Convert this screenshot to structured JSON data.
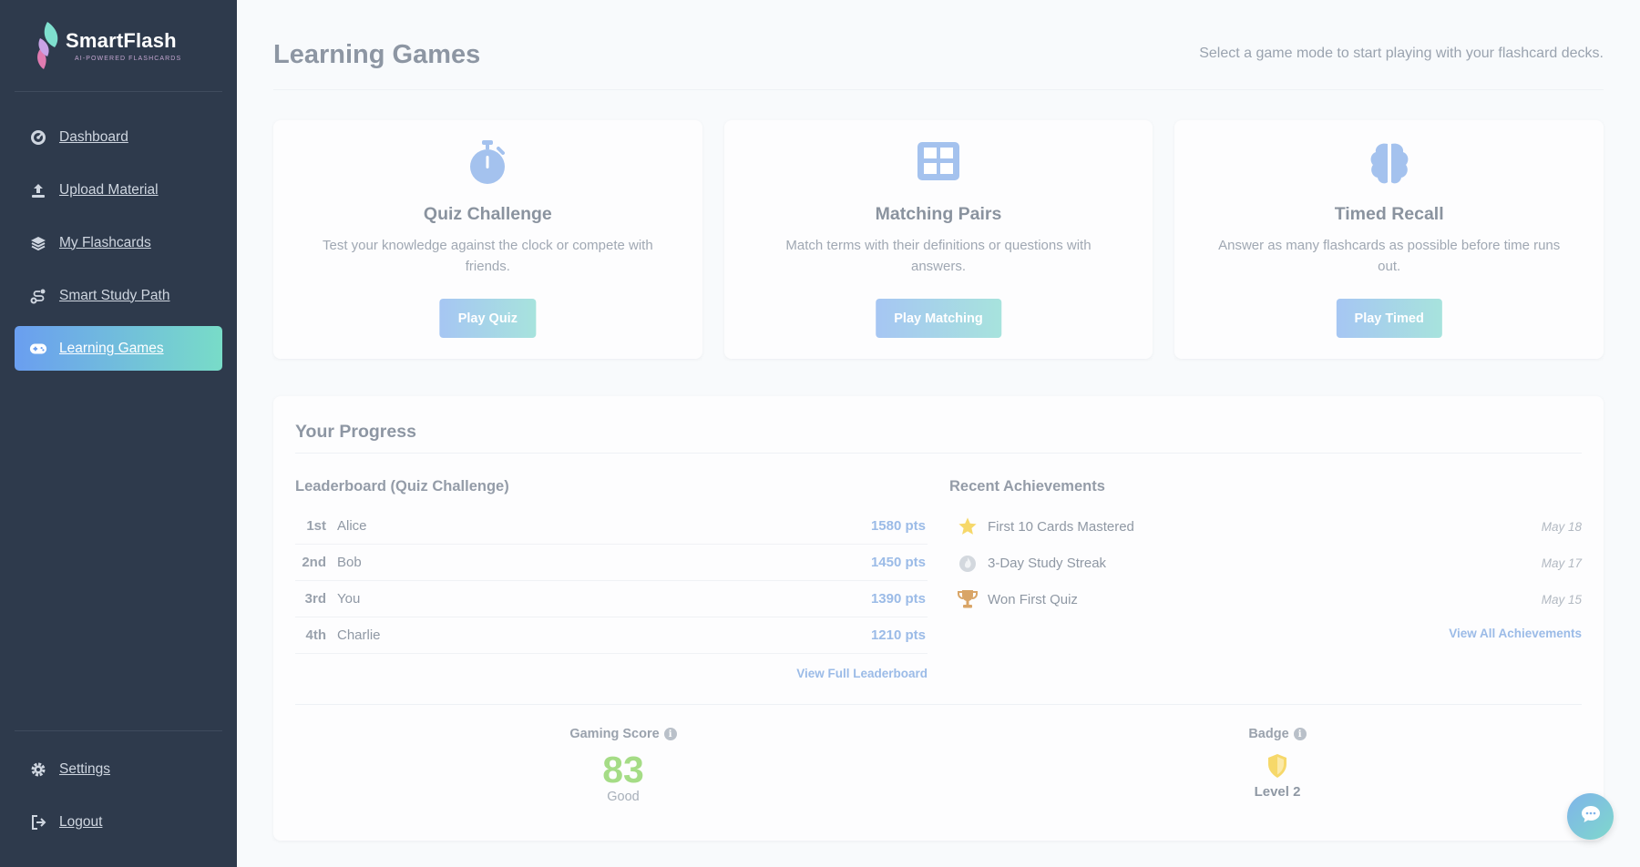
{
  "app": {
    "name": "SmartFlash",
    "tagline": "AI-POWERED FLASHCARDS"
  },
  "sidebar": {
    "items": [
      {
        "label": "Dashboard",
        "icon": "gauge-icon",
        "active": false
      },
      {
        "label": "Upload Material",
        "icon": "upload-icon",
        "active": false
      },
      {
        "label": "My Flashcards",
        "icon": "layers-icon",
        "active": false
      },
      {
        "label": "Smart Study Path",
        "icon": "route-icon",
        "active": false
      },
      {
        "label": "Learning Games",
        "icon": "gamepad-icon",
        "active": true
      }
    ],
    "bottom_items": [
      {
        "label": "Settings",
        "icon": "gear-icon"
      },
      {
        "label": "Logout",
        "icon": "logout-icon"
      }
    ]
  },
  "header": {
    "title": "Learning Games",
    "subtitle": "Select a game mode to start playing with your flashcard decks."
  },
  "games": [
    {
      "title": "Quiz Challenge",
      "description": "Test your knowledge against the clock or compete with friends.",
      "button": "Play Quiz",
      "icon": "stopwatch-icon"
    },
    {
      "title": "Matching Pairs",
      "description": "Match terms with their definitions or questions with answers.",
      "button": "Play Matching",
      "icon": "grid-icon"
    },
    {
      "title": "Timed Recall",
      "description": "Answer as many flashcards as possible before time runs out.",
      "button": "Play Timed",
      "icon": "brain-icon"
    }
  ],
  "progress": {
    "title": "Your Progress",
    "leaderboard": {
      "title": "Leaderboard (Quiz Challenge)",
      "rows": [
        {
          "rank": "1st",
          "name": "Alice",
          "points": "1580 pts"
        },
        {
          "rank": "2nd",
          "name": "Bob",
          "points": "1450 pts"
        },
        {
          "rank": "3rd",
          "name": "You",
          "points": "1390 pts"
        },
        {
          "rank": "4th",
          "name": "Charlie",
          "points": "1210 pts"
        }
      ],
      "link": "View Full Leaderboard"
    },
    "achievements": {
      "title": "Recent Achievements",
      "items": [
        {
          "name": "First 10 Cards Mastered",
          "date": "May 18",
          "icon": "star-icon"
        },
        {
          "name": "3-Day Study Streak",
          "date": "May 17",
          "icon": "flame-icon"
        },
        {
          "name": "Won First Quiz",
          "date": "May 15",
          "icon": "trophy-icon"
        }
      ],
      "link": "View All Achievements"
    },
    "gaming_score": {
      "label": "Gaming Score",
      "value": "83",
      "rating": "Good"
    },
    "badge": {
      "label": "Badge",
      "level": "Level 2",
      "icon": "shield-icon"
    }
  },
  "colors": {
    "sidebar_bg": "#2e3a4c",
    "accent_start": "#6a9ef0",
    "accent_end": "#78dcc8",
    "score_green": "#a5dc86",
    "star_yellow": "#f6d86a",
    "trophy_gold": "#d9a567"
  }
}
